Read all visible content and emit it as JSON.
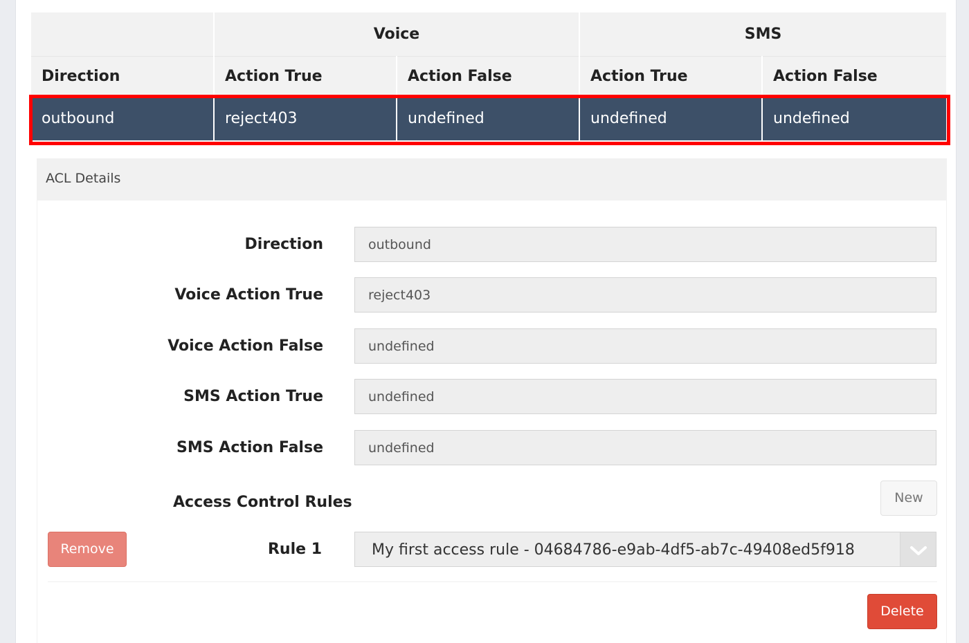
{
  "table": {
    "group_headers": {
      "voice": "Voice",
      "sms": "SMS"
    },
    "columns": [
      "Direction",
      "Action True",
      "Action False",
      "Action True",
      "Action False"
    ],
    "rows": [
      [
        "outbound",
        "reject403",
        "undefined",
        "undefined",
        "undefined"
      ]
    ]
  },
  "details": {
    "title": "ACL Details",
    "fields": [
      {
        "label": "Direction",
        "value": "outbound"
      },
      {
        "label": "Voice Action True",
        "value": "reject403"
      },
      {
        "label": "Voice Action False",
        "value": "undefined"
      },
      {
        "label": "SMS Action True",
        "value": "undefined"
      },
      {
        "label": "SMS Action False",
        "value": "undefined"
      }
    ],
    "rules_label": "Access Control Rules",
    "new_label": "New",
    "remove_label": "Remove",
    "rule_label": "Rule 1",
    "rule_value": "My first access rule - 04684786-e9ab-4df5-ab7c-49408ed5f918",
    "delete_label": "Delete"
  },
  "colors": {
    "selected_row": "#3d5068",
    "highlight_border": "#ff0000",
    "delete": "#e04b38",
    "remove": "#e8847a"
  }
}
